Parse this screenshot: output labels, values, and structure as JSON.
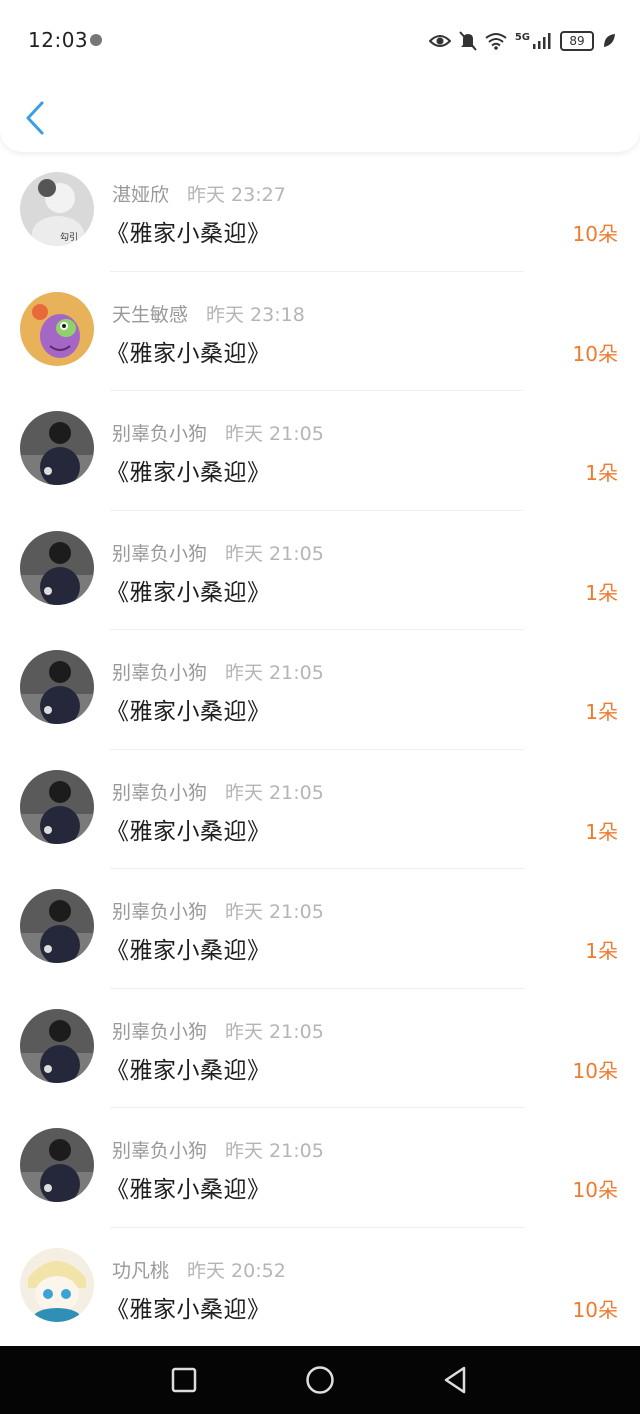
{
  "status_bar": {
    "time": "12:03",
    "network": "5G",
    "battery": "89"
  },
  "header": {
    "back_icon": "chevron-left-icon"
  },
  "colors": {
    "accent_blue": "#3a9de5",
    "amount_orange": "#f07a2e"
  },
  "rows": [
    {
      "name": "湛娅欣",
      "time": "昨天 23:27",
      "title": "《雅家小桑迎》",
      "amount": "10朵"
    },
    {
      "name": "天生敏感",
      "time": "昨天 23:18",
      "title": "《雅家小桑迎》",
      "amount": "10朵"
    },
    {
      "name": "别辜负小狗",
      "time": "昨天 21:05",
      "title": "《雅家小桑迎》",
      "amount": "1朵"
    },
    {
      "name": "别辜负小狗",
      "time": "昨天 21:05",
      "title": "《雅家小桑迎》",
      "amount": "1朵"
    },
    {
      "name": "别辜负小狗",
      "time": "昨天 21:05",
      "title": "《雅家小桑迎》",
      "amount": "1朵"
    },
    {
      "name": "别辜负小狗",
      "time": "昨天 21:05",
      "title": "《雅家小桑迎》",
      "amount": "1朵"
    },
    {
      "name": "别辜负小狗",
      "time": "昨天 21:05",
      "title": "《雅家小桑迎》",
      "amount": "1朵"
    },
    {
      "name": "别辜负小狗",
      "time": "昨天 21:05",
      "title": "《雅家小桑迎》",
      "amount": "10朵"
    },
    {
      "name": "别辜负小狗",
      "time": "昨天 21:05",
      "title": "《雅家小桑迎》",
      "amount": "10朵"
    },
    {
      "name": "功凡桃",
      "time": "昨天 20:52",
      "title": "《雅家小桑迎》",
      "amount": "10朵"
    }
  ]
}
